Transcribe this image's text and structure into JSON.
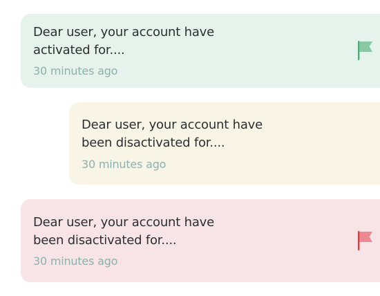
{
  "notifications": [
    {
      "message": "Dear user, your account have\nactivated for....",
      "time": "30 minutes ago",
      "flag_icon": "flag-icon",
      "flag_color": "#4caf7a",
      "background": "#e6f2ec"
    },
    {
      "message": "Dear user, your account have\nbeen disactivated for....",
      "time": "30 minutes ago",
      "background": "#f8f5e6"
    },
    {
      "message": "Dear user, your account have\nbeen disactivated for....",
      "time": "30 minutes ago",
      "flag_icon": "flag-icon",
      "flag_color": "#e0555f",
      "background": "#f8e4e6"
    }
  ]
}
